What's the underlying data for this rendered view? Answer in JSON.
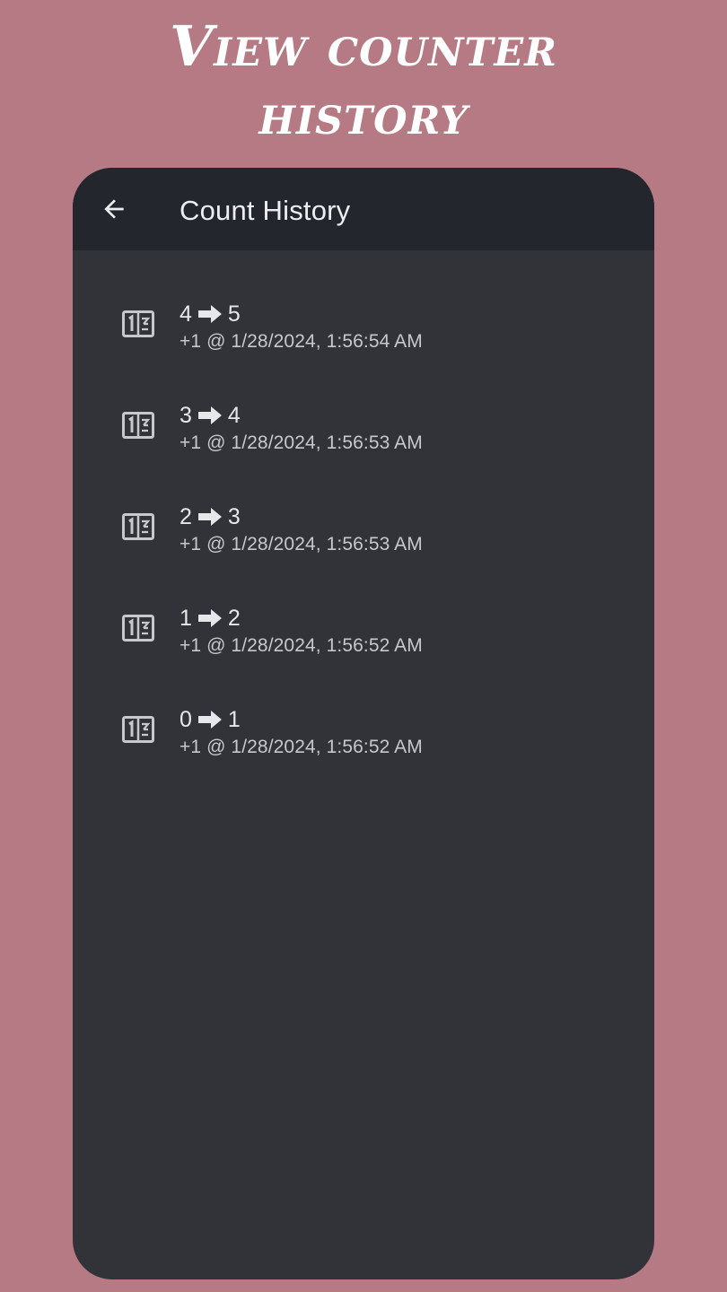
{
  "headline": {
    "line1": "View counter",
    "line2": "history"
  },
  "appbar": {
    "title": "Count History",
    "back_icon": "arrow-left-icon"
  },
  "history": [
    {
      "from": "4",
      "to": "5",
      "detail": "+1 @ 1/28/2024, 1:56:54 AM",
      "icon": "counter-icon"
    },
    {
      "from": "3",
      "to": "4",
      "detail": "+1 @ 1/28/2024, 1:56:53 AM",
      "icon": "counter-icon"
    },
    {
      "from": "2",
      "to": "3",
      "detail": "+1 @ 1/28/2024, 1:56:53 AM",
      "icon": "counter-icon"
    },
    {
      "from": "1",
      "to": "2",
      "detail": "+1 @ 1/28/2024, 1:56:52 AM",
      "icon": "counter-icon"
    },
    {
      "from": "0",
      "to": "1",
      "detail": "+1 @ 1/28/2024, 1:56:52 AM",
      "icon": "counter-icon"
    }
  ],
  "colors": {
    "background": "#b57a83",
    "screen": "#323338",
    "appbar": "#24262e",
    "text_primary": "#e6e7eb",
    "text_secondary": "#c6c8ce"
  }
}
